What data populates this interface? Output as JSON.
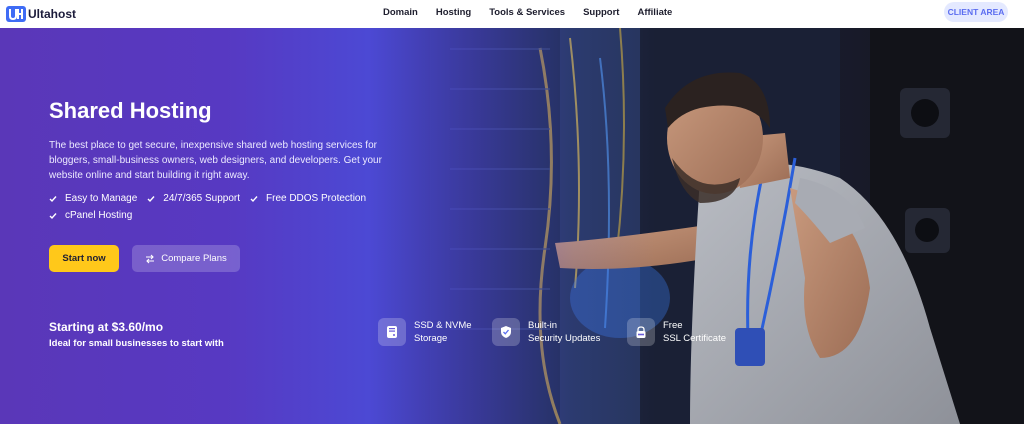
{
  "header": {
    "logo_text": "Ultahost",
    "nav": [
      "Domain",
      "Hosting",
      "Tools & Services",
      "Support",
      "Affiliate"
    ],
    "client_area": "CLIENT AREA"
  },
  "hero": {
    "title": "Shared Hosting",
    "description": "The best place to get secure, inexpensive shared web hosting services for bloggers, small-business owners, web designers, and developers. Get your website online and start building it right away.",
    "features": [
      "Easy to Manage",
      "24/7/365 Support",
      "Free DDOS Protection",
      "cPanel Hosting"
    ],
    "start_button": "Start now",
    "compare_button": "Compare Plans",
    "price_heading": "Starting at $3.60/mo",
    "price_sub": "Ideal for small businesses to start with",
    "badges": [
      {
        "line1": "SSD & NVMe",
        "line2": "Storage",
        "icon": "storage-icon"
      },
      {
        "line1": "Built-in",
        "line2": "Security Updates",
        "icon": "shield-check-icon"
      },
      {
        "line1": "Free",
        "line2": "SSL Certificate",
        "icon": "ssl-lock-icon"
      }
    ]
  },
  "colors": {
    "brand_purple": "#5a37b8",
    "accent_yellow": "#ffc81a",
    "client_bg": "#e4e9ff",
    "client_text": "#5b6df0"
  }
}
